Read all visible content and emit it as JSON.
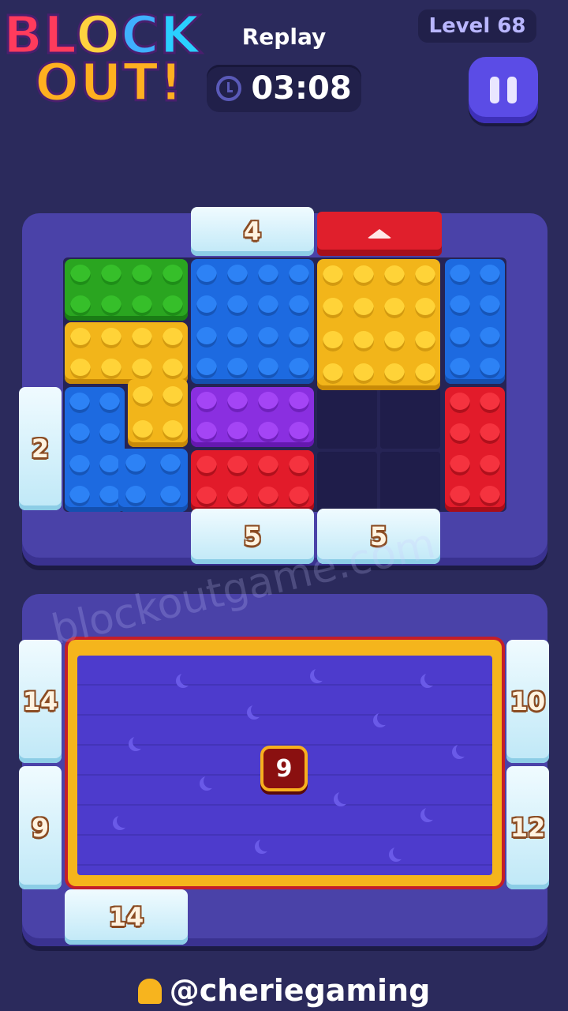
{
  "header": {
    "logo_line1": [
      "BL",
      "O",
      "C",
      "K"
    ],
    "logo_line2": "OUT!",
    "mode_label": "Replay",
    "timer": "03:08",
    "level": "Level 68",
    "icons": {
      "timer": "clock-icon",
      "pause": "pause-icon"
    }
  },
  "board": {
    "gates": {
      "top_left": "4",
      "left": "2",
      "bottom_left": "5",
      "bottom_right": "5"
    },
    "exit_icon": "arrow-up-icon",
    "blocks": [
      "green",
      "blue",
      "yellow",
      "blue",
      "yellow",
      "blue",
      "purple",
      "red",
      "red"
    ],
    "colors": {
      "green": "#2aa520",
      "blue": "#1d6ae0",
      "yellow": "#f2b51a",
      "purple": "#8a2fe0",
      "red": "#e21b2a"
    }
  },
  "tray": {
    "gates": {
      "left_top": "14",
      "left_bottom": "9",
      "right_top": "10",
      "right_bottom": "12",
      "bottom": "14"
    },
    "center_badge": "9"
  },
  "watermark": "blockoutgame.com",
  "footer": {
    "handle": "@cheriegaming",
    "icon": "bell-icon"
  }
}
